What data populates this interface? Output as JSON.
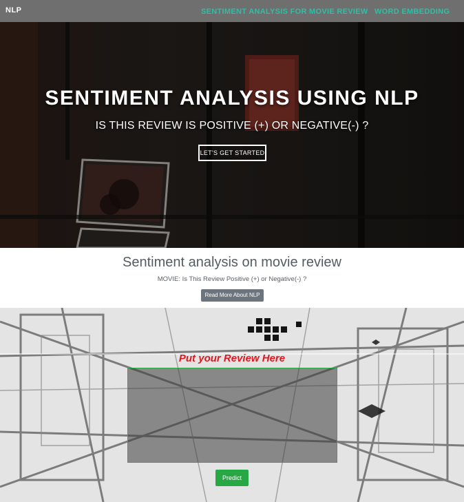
{
  "navbar": {
    "brand": "NLP",
    "links": [
      {
        "label": "SENTIMENT ANALYSIS FOR MOVIE REVIEW"
      },
      {
        "label": "WORD EMBEDDING"
      }
    ],
    "link_color": "#2fbfa5",
    "background": "#6f6f6f"
  },
  "hero": {
    "title": "SENTIMENT ANALYSIS USING NLP",
    "subtitle": "IS THIS REVIEW IS POSITIVE (+) OR NEGATIVE(-) ?",
    "button_label": "LET'S GET STARTED"
  },
  "about": {
    "title": "Sentiment analysis on movie review",
    "text": "MOVIE: Is This Review Positive (+) or Negative(-) ?",
    "button_label": "Read More About NLP"
  },
  "predict": {
    "heading": "Put your Review Here",
    "review_value": "",
    "button_label": "Predict",
    "heading_color": "#e0161e",
    "button_color": "#28a745"
  }
}
